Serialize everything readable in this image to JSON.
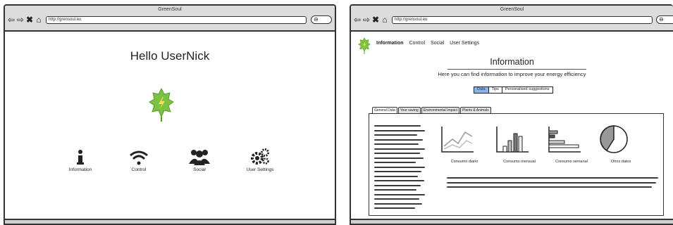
{
  "left_window": {
    "title": "GreenSoul",
    "url": "http://grensoul.eu",
    "greeting": "Hello UserNick",
    "menu": [
      {
        "label": "Information",
        "icon": "info-icon"
      },
      {
        "label": "Control",
        "icon": "wifi-icon"
      },
      {
        "label": "Social",
        "icon": "users-icon"
      },
      {
        "label": "User Settings",
        "icon": "gears-icon"
      }
    ],
    "leaf_color": "#7dc143"
  },
  "right_window": {
    "title": "GreenSoul",
    "url": "http://grensoul.eu",
    "nav": [
      "Information",
      "Control",
      "Social",
      "User Settings"
    ],
    "heading": "Information",
    "subheading": "Here you can find information to improve your energy efficiency",
    "segments": [
      "Data",
      "Tips",
      "Personalised suggestions"
    ],
    "selected_segment": "Data",
    "tabs": [
      "General Data",
      "Your saving",
      "Environmental Impact",
      "Plants & Animals"
    ],
    "selected_tab": "General Data",
    "charts": [
      {
        "label": "Consumo diario",
        "icon": "line-chart-icon"
      },
      {
        "label": "Consumo mensual",
        "icon": "bar-chart-icon"
      },
      {
        "label": "Consumo semanal",
        "icon": "horizontal-bar-chart-icon"
      },
      {
        "label": "Otros datos",
        "icon": "pie-chart-icon"
      }
    ],
    "accent": "#8cb4e4"
  }
}
